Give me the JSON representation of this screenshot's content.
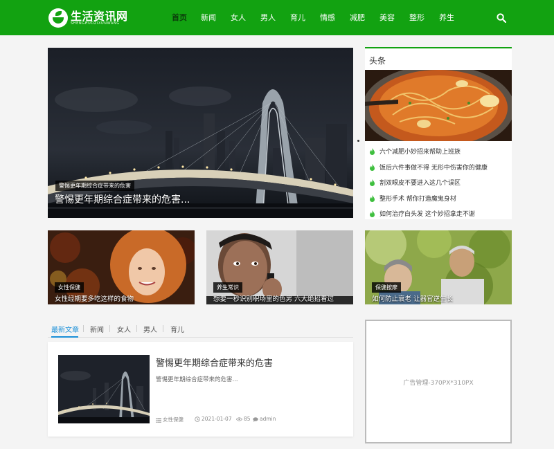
{
  "header": {
    "logo_title": "生活资讯网",
    "logo_subtitle": "SHENGHUOZIXUNWANG",
    "nav": [
      {
        "label": "首页",
        "active": true
      },
      {
        "label": "新闻"
      },
      {
        "label": "女人"
      },
      {
        "label": "男人"
      },
      {
        "label": "育儿"
      },
      {
        "label": "情感"
      },
      {
        "label": "减肥"
      },
      {
        "label": "美容"
      },
      {
        "label": "整形"
      },
      {
        "label": "养生"
      }
    ]
  },
  "hero": {
    "tag": "警惕更年期综合症带来的危害",
    "title": "警惕更年期综合症带来的危害..."
  },
  "headlines": {
    "title": "头条",
    "items": [
      "六个减肥小妙招来帮助上班族",
      "饭后六件事做不得 无形中伤害你的健康",
      "割双眼皮不要进入这几个误区",
      "整形手术 帮你打造魔鬼身材",
      "如何治疗白头发 这个妙招拿走不谢"
    ]
  },
  "cards": [
    {
      "tag": "女性保健",
      "title": "女性经期要多吃这样的食物"
    },
    {
      "tag": "养生常识",
      "title": "想要一秒识别职场里的色男 六大绝招看过"
    },
    {
      "tag": "保健按摩",
      "title": "如何防止衰老 让器官逆生长"
    }
  ],
  "tabs": [
    {
      "label": "最新文章",
      "active": true
    },
    {
      "label": "新闻"
    },
    {
      "label": "女人"
    },
    {
      "label": "男人"
    },
    {
      "label": "育儿"
    }
  ],
  "article": {
    "title": "警惕更年期综合症带来的危害",
    "excerpt": "警惕更年期综合症带来的危害...",
    "category": "女性保健",
    "date": "2021-01-07",
    "views": "85",
    "author": "admin"
  },
  "ad": {
    "text": "广告管理-370PX*310PX"
  },
  "colors": {
    "brand": "#12a211",
    "tab_active": "#1a8fd8",
    "flame": "#3fbf3f"
  }
}
